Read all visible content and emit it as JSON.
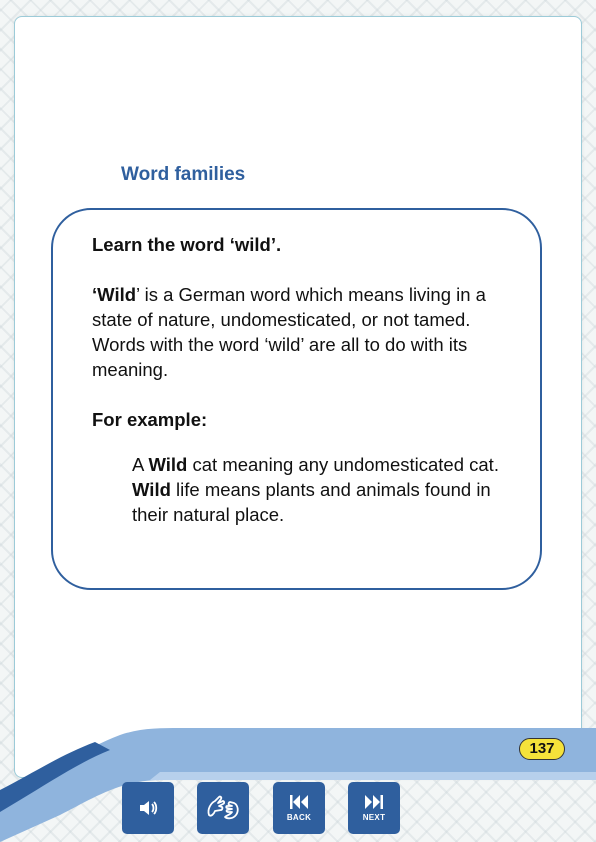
{
  "section": {
    "title": "Word families"
  },
  "card": {
    "lead": "Learn the word ‘wild’.",
    "para_bold": "‘Wild",
    "para_rest": "’ is a German word which means living in a state of nature,  undomesticated, or not tamed. Words with the word ‘wild’ are all to do with its meaning.",
    "example_heading": "For example:",
    "examples": [
      {
        "pre": "A ",
        "bold": "Wild",
        "post": " cat meaning any undomesticated cat."
      },
      {
        "pre": "",
        "bold": "Wild",
        "post": " life means plants and animals found in their natural place."
      }
    ]
  },
  "page_number": "137",
  "nav": {
    "audio_icon": "speaker-icon",
    "sign_icon": "sign-language-icon",
    "back_label": "BACK",
    "next_label": "NEXT"
  },
  "colors": {
    "accent": "#2f5f9e",
    "wave_light": "#8fb4dd",
    "badge": "#f5e23a"
  }
}
